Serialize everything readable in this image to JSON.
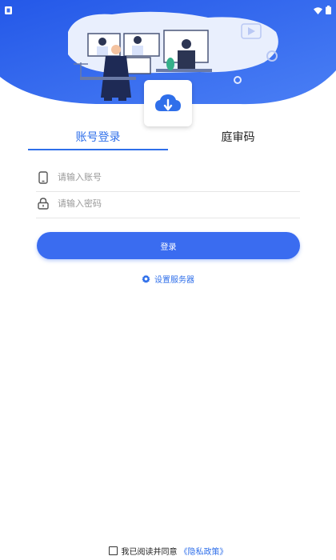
{
  "tabs": [
    {
      "label": "账号登录",
      "active": true
    },
    {
      "label": "庭审码",
      "active": false
    }
  ],
  "form": {
    "account_placeholder": "请输入账号",
    "password_placeholder": "请输入密码",
    "account_icon": "phone-icon",
    "password_icon": "lock-icon"
  },
  "login_button": "登录",
  "server_setting": {
    "label": "设置服务器",
    "icon": "gear-icon"
  },
  "agreement": {
    "text": "我已阅读并同意",
    "link": "《隐私政策》"
  },
  "colors": {
    "primary": "#3a6cf0",
    "link": "#2f6fea",
    "hero_blue": "#2f5fe6"
  }
}
